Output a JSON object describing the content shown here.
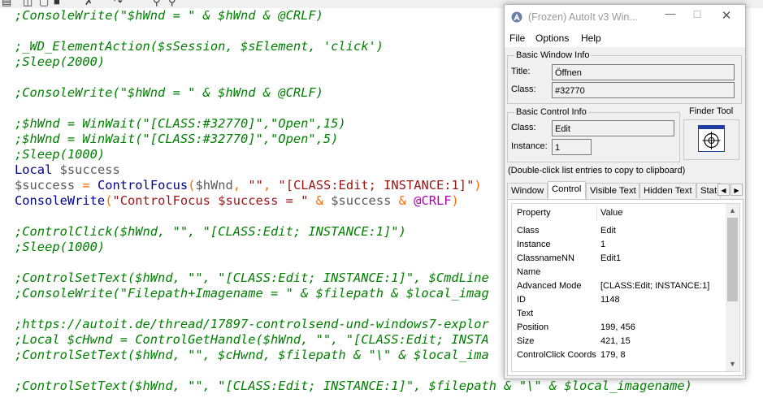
{
  "toolbar": {
    "icons": [
      "printer-icon",
      "copy-icon",
      "paste-icon",
      "cut-icon",
      "undo-icon",
      "redo-icon",
      "find-icon",
      "replace-icon"
    ]
  },
  "editor": {
    "lines": [
      [
        {
          "t": ";ConsoleWrite(\"$hWnd = \" & $hWnd & @CRLF)",
          "c": "cmt"
        }
      ],
      [],
      [
        {
          "t": ";_WD_ElementAction($sSession, $sElement, 'click')",
          "c": "cmt"
        }
      ],
      [
        {
          "t": ";Sleep(2000)",
          "c": "cmt"
        }
      ],
      [],
      [
        {
          "t": ";ConsoleWrite(\"$hWnd = \" & $hWnd & @CRLF)",
          "c": "cmt"
        }
      ],
      [],
      [
        {
          "t": ";$hWnd = WinWait(\"[CLASS:#32770]\",\"Open\",15)",
          "c": "cmt"
        }
      ],
      [
        {
          "t": ";$hWnd = WinWait(\"[CLASS:#32770]\",\"Open\",5)",
          "c": "cmt"
        }
      ],
      [
        {
          "t": ";Sleep(1000)",
          "c": "cmt"
        }
      ],
      [
        {
          "t": "Local ",
          "c": "kw"
        },
        {
          "t": "$success",
          "c": "var"
        }
      ],
      [
        {
          "t": "$success",
          "c": "var"
        },
        {
          "t": " = ",
          "c": "op"
        },
        {
          "t": "ControlFocus",
          "c": "fn"
        },
        {
          "t": "(",
          "c": "op"
        },
        {
          "t": "$hWnd",
          "c": "var"
        },
        {
          "t": ", ",
          "c": "op"
        },
        {
          "t": "\"\"",
          "c": "str"
        },
        {
          "t": ", ",
          "c": "op"
        },
        {
          "t": "\"[CLASS:Edit; INSTANCE:1]\"",
          "c": "str"
        },
        {
          "t": ")",
          "c": "op"
        }
      ],
      [
        {
          "t": "ConsoleWrite",
          "c": "fn"
        },
        {
          "t": "(",
          "c": "op"
        },
        {
          "t": "\"ControlFocus $success = \"",
          "c": "str"
        },
        {
          "t": " & ",
          "c": "op"
        },
        {
          "t": "$success",
          "c": "var"
        },
        {
          "t": " & ",
          "c": "op"
        },
        {
          "t": "@CRLF",
          "c": "mac"
        },
        {
          "t": ")",
          "c": "op"
        }
      ],
      [],
      [
        {
          "t": ";ControlClick($hWnd, \"\", \"[CLASS:Edit; INSTANCE:1]\")",
          "c": "cmt"
        }
      ],
      [
        {
          "t": ";Sleep(1000)",
          "c": "cmt"
        }
      ],
      [],
      [
        {
          "t": ";ControlSetText($hWnd, \"\", \"[CLASS:Edit; INSTANCE:1]\", $CmdLine",
          "c": "cmt"
        }
      ],
      [
        {
          "t": ";ConsoleWrite(\"Filepath+Imagename = \" & $filepath & $local_imag",
          "c": "cmt"
        }
      ],
      [],
      [
        {
          "t": ";https://autoit.de/thread/17897-controlsend-und-windows7-explor",
          "c": "cmt"
        }
      ],
      [
        {
          "t": ";Local $cHwnd = ControlGetHandle($hWnd, \"\", \"[CLASS:Edit; INSTA",
          "c": "cmt"
        }
      ],
      [
        {
          "t": ";ControlSetText($hWnd, \"\", $cHwnd, $filepath & \"\\\" & $local_ima",
          "c": "cmt"
        }
      ],
      [],
      [
        {
          "t": ";ControlSetText($hWnd, \"\", \"[CLASS:Edit; INSTANCE:1]\", $filepath & \"\\\" & $local_imagename)",
          "c": "cmt"
        }
      ]
    ]
  },
  "autoit": {
    "title": "(Frozen) AutoIt v3 Win...",
    "menu": [
      "File",
      "Options",
      "Help"
    ],
    "basic_window": {
      "label": "Basic Window Info",
      "title_label": "Title:",
      "title_value": "Öffnen",
      "class_label": "Class:",
      "class_value": "#32770"
    },
    "basic_control": {
      "label": "Basic Control Info",
      "class_label": "Class:",
      "class_value": "Edit",
      "instance_label": "Instance:",
      "instance_value": "1"
    },
    "finder": {
      "label": "Finder Tool"
    },
    "hint": "(Double-click list entries to copy to clipboard)",
    "tabs": [
      "Window",
      "Control",
      "Visible Text",
      "Hidden Text",
      "Stat"
    ],
    "active_tab": "Control",
    "list": {
      "headers": [
        "Property",
        "Value"
      ],
      "rows": [
        [
          "Class",
          "Edit"
        ],
        [
          "Instance",
          "1"
        ],
        [
          "ClassnameNN",
          "Edit1"
        ],
        [
          "Name",
          ""
        ],
        [
          "Advanced Mode",
          "[CLASS:Edit; INSTANCE:1]"
        ],
        [
          "ID",
          "1148"
        ],
        [
          "Text",
          ""
        ],
        [
          "Position",
          "199, 456"
        ],
        [
          "Size",
          "421, 15"
        ],
        [
          "ControlClick Coords",
          "179, 8"
        ]
      ]
    }
  }
}
